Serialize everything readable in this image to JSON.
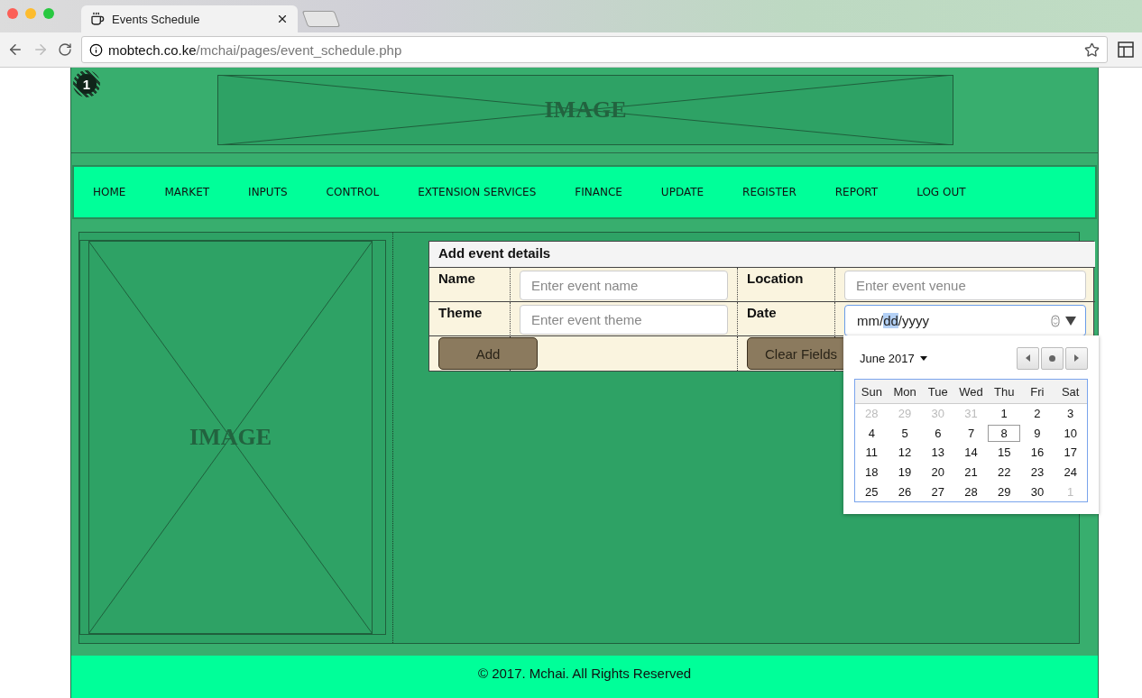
{
  "browser": {
    "tab_title": "Events Schedule",
    "url_host": "mobtech.co.ke",
    "url_path": "/mchai/pages/event_schedule.php"
  },
  "badge": "1",
  "header_image": {
    "label": "IMAGE"
  },
  "nav": [
    "HOME",
    "MARKET",
    "INPUTS",
    "CONTROL",
    "EXTENSION SERVICES",
    "FINANCE",
    "UPDATE",
    "REGISTER",
    "REPORT",
    "LOG OUT"
  ],
  "side_image": {
    "label": "IMAGE"
  },
  "form": {
    "title": "Add event details",
    "rows": [
      [
        {
          "label": "Name",
          "placeholder": "Enter event name"
        },
        {
          "label": "Location",
          "placeholder": "Enter event venue"
        }
      ],
      [
        {
          "label": "Theme",
          "placeholder": "Enter event theme"
        },
        {
          "label": "Date",
          "kind": "date"
        }
      ]
    ],
    "date_segments": [
      {
        "text": "mm",
        "selected": false
      },
      {
        "text": "/",
        "selected": false
      },
      {
        "text": "dd",
        "selected": true
      },
      {
        "text": "/",
        "selected": false
      },
      {
        "text": "yyyy",
        "selected": false
      }
    ],
    "buttons": [
      "Add",
      "Clear Fields"
    ]
  },
  "calendar": {
    "month": "June 2017",
    "weekdays": [
      "Sun",
      "Mon",
      "Tue",
      "Wed",
      "Thu",
      "Fri",
      "Sat"
    ],
    "weeks": [
      [
        {
          "day": "28",
          "outside": true,
          "today": false
        },
        {
          "day": "29",
          "outside": true,
          "today": false
        },
        {
          "day": "30",
          "outside": true,
          "today": false
        },
        {
          "day": "31",
          "outside": true,
          "today": false
        },
        {
          "day": "1",
          "outside": false,
          "today": false
        },
        {
          "day": "2",
          "outside": false,
          "today": false
        },
        {
          "day": "3",
          "outside": false,
          "today": false
        }
      ],
      [
        {
          "day": "4",
          "outside": false,
          "today": false
        },
        {
          "day": "5",
          "outside": false,
          "today": false
        },
        {
          "day": "6",
          "outside": false,
          "today": false
        },
        {
          "day": "7",
          "outside": false,
          "today": false
        },
        {
          "day": "8",
          "outside": false,
          "today": true
        },
        {
          "day": "9",
          "outside": false,
          "today": false
        },
        {
          "day": "10",
          "outside": false,
          "today": false
        }
      ],
      [
        {
          "day": "11",
          "outside": false,
          "today": false
        },
        {
          "day": "12",
          "outside": false,
          "today": false
        },
        {
          "day": "13",
          "outside": false,
          "today": false
        },
        {
          "day": "14",
          "outside": false,
          "today": false
        },
        {
          "day": "15",
          "outside": false,
          "today": false
        },
        {
          "day": "16",
          "outside": false,
          "today": false
        },
        {
          "day": "17",
          "outside": false,
          "today": false
        }
      ],
      [
        {
          "day": "18",
          "outside": false,
          "today": false
        },
        {
          "day": "19",
          "outside": false,
          "today": false
        },
        {
          "day": "20",
          "outside": false,
          "today": false
        },
        {
          "day": "21",
          "outside": false,
          "today": false
        },
        {
          "day": "22",
          "outside": false,
          "today": false
        },
        {
          "day": "23",
          "outside": false,
          "today": false
        },
        {
          "day": "24",
          "outside": false,
          "today": false
        }
      ],
      [
        {
          "day": "25",
          "outside": false,
          "today": false
        },
        {
          "day": "26",
          "outside": false,
          "today": false
        },
        {
          "day": "27",
          "outside": false,
          "today": false
        },
        {
          "day": "28",
          "outside": false,
          "today": false
        },
        {
          "day": "29",
          "outside": false,
          "today": false
        },
        {
          "day": "30",
          "outside": false,
          "today": false
        },
        {
          "day": "1",
          "outside": true,
          "today": false
        }
      ]
    ]
  },
  "footer": "© 2017. Mchai. All Rights Reserved"
}
